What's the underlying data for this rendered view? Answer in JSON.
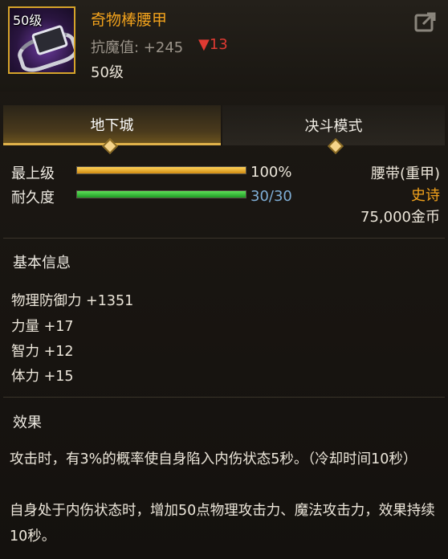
{
  "item": {
    "icon_level": "50级",
    "icon": "belt-icon",
    "name": "奇物棒腰甲",
    "resist_text": "抗魔值: +245",
    "resist_down": "▼13",
    "required_level": "50级"
  },
  "tabs": [
    {
      "label": "地下城",
      "active": true
    },
    {
      "label": "决斗模式",
      "active": false
    }
  ],
  "stats": {
    "max_level_label": "最上级",
    "max_level_value": "100%",
    "max_level_fraction": 1.0,
    "durability_label": "耐久度",
    "durability_value": "30/30",
    "durability_fraction": 1.0
  },
  "type": {
    "slot": "腰带(重甲)",
    "rarity": "史诗",
    "price": "75,000金币"
  },
  "basic": {
    "title": "基本信息",
    "lines": [
      "物理防御力 +1351",
      "力量 +17",
      "智力 +12",
      "体力 +15"
    ]
  },
  "effect": {
    "title": "效果",
    "lines": [
      "攻击时，有3%的概率使自身陷入内伤状态5秒。（冷却时间10秒）",
      "自身处于内伤状态时，增加50点物理攻击力、魔法攻击力，效果持续10秒。"
    ]
  },
  "colors": {
    "name": "#f2a21c",
    "rarity": "#f2a21c",
    "resist_down": "#e03a32",
    "durability_value": "#7faed6"
  }
}
